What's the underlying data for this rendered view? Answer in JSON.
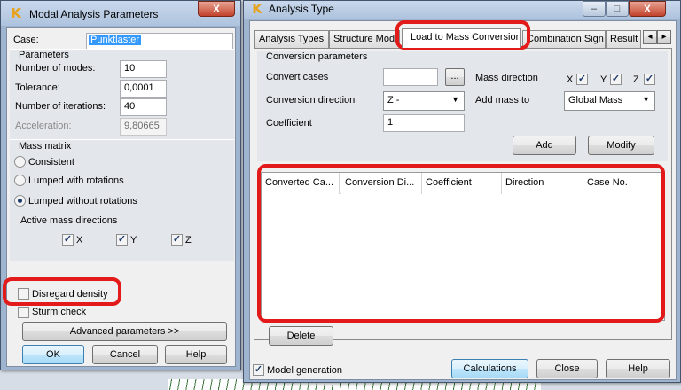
{
  "modal": {
    "title": "Modal Analysis Parameters",
    "close_label": "X",
    "case_label": "Case:",
    "case_value": "Punktlaster",
    "parameters_title": "Parameters",
    "modes_label": "Number of modes:",
    "modes_value": "10",
    "tolerance_label": "Tolerance:",
    "tolerance_value": "0,0001",
    "iterations_label": "Number of iterations:",
    "iterations_value": "40",
    "acceleration_label": "Acceleration:",
    "acceleration_value": "9,80665",
    "mass_matrix_title": "Mass matrix",
    "consistent_label": "Consistent",
    "lumped_rot_label": "Lumped with rotations",
    "lumped_norot_label": "Lumped without rotations",
    "active_dirs_title": "Active mass directions",
    "dir_x": "X",
    "dir_y": "Y",
    "dir_z": "Z",
    "disregard_density_label": "Disregard density",
    "sturm_check_label": "Sturm check",
    "advanced_label": "Advanced parameters >>",
    "ok_label": "OK",
    "cancel_label": "Cancel",
    "help_label": "Help"
  },
  "analysis": {
    "title": "Analysis Type",
    "close_label": "X",
    "minimize_label": "–",
    "maximize_label": "□",
    "tabs": [
      "Analysis Types",
      "Structure Model",
      "Load to Mass Conversion",
      "Combination Sign",
      "Result M"
    ],
    "tab_prev": "◂",
    "tab_next": "▸",
    "conv_params_title": "Conversion parameters",
    "convert_cases_label": "Convert cases",
    "browse_label": "...",
    "mass_direction_label": "Mass direction",
    "dir_x": "X",
    "dir_y": "Y",
    "dir_z": "Z",
    "conv_direction_label": "Conversion direction",
    "conv_direction_value": "Z -",
    "add_mass_to_label": "Add mass to",
    "add_mass_to_value": "Global Mass",
    "coefficient_label": "Coefficient",
    "coefficient_value": "1",
    "add_label": "Add",
    "modify_label": "Modify",
    "columns": [
      "Converted Ca...",
      "Conversion Di...",
      "Coefficient",
      "Direction",
      "Case No."
    ],
    "delete_label": "Delete",
    "model_generation_label": "Model generation",
    "calculations_label": "Calculations",
    "close_button_label": "Close",
    "help_label": "Help"
  }
}
